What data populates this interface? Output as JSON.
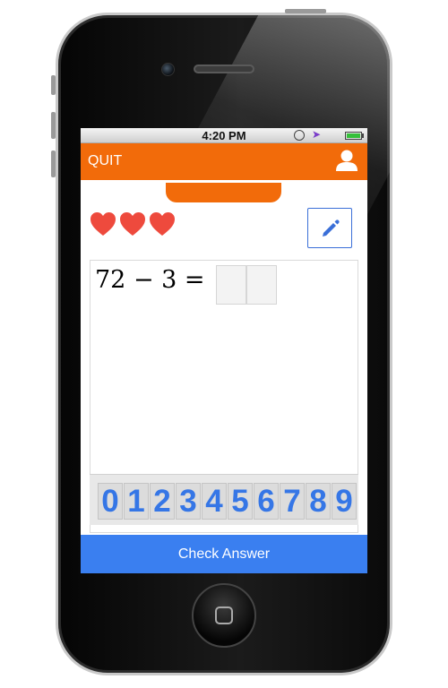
{
  "status_bar": {
    "time": "4:20 PM"
  },
  "header": {
    "quit_label": "QUIT",
    "icon": "user-icon"
  },
  "lives": {
    "count": 3,
    "icon": "heart-icon",
    "color": "#ee4a3d"
  },
  "edit_button": {
    "icon": "pencil-icon"
  },
  "problem": {
    "equation": "72 − 3 =",
    "answer_slots": 2
  },
  "digit_pad": {
    "digits": [
      "0",
      "1",
      "2",
      "3",
      "4",
      "5",
      "6",
      "7",
      "8",
      "9"
    ]
  },
  "check_button": {
    "label": "Check Answer"
  },
  "colors": {
    "accent_orange": "#f26b0a",
    "accent_blue": "#3a7ff0",
    "digit_blue": "#3576e6"
  }
}
